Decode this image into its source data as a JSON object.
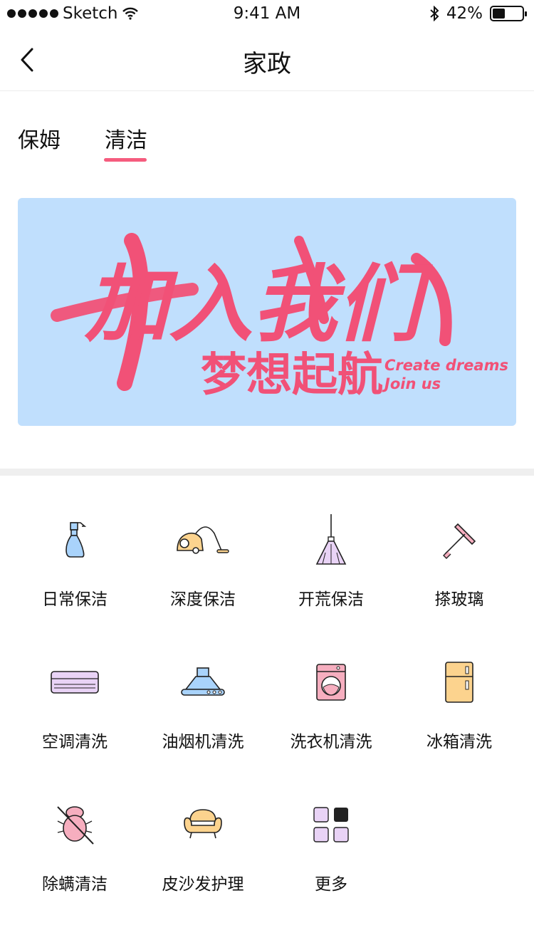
{
  "status": {
    "carrier": "Sketch",
    "time": "9:41 AM",
    "battery": "42%",
    "battery_level": 0.42
  },
  "nav": {
    "title": "家政"
  },
  "tabs": [
    {
      "label": "保姆",
      "active": false
    },
    {
      "label": "清洁",
      "active": true
    }
  ],
  "banner": {
    "headline": "加入我们",
    "subline": "梦想起航",
    "en_line1": "Create dreams",
    "en_line2": "Join us"
  },
  "services": [
    {
      "label": "日常保洁",
      "icon": "spray-bottle-icon"
    },
    {
      "label": "深度保洁",
      "icon": "vacuum-cleaner-icon"
    },
    {
      "label": "开荒保洁",
      "icon": "broom-icon"
    },
    {
      "label": "搽玻璃",
      "icon": "window-squeegee-icon"
    },
    {
      "label": "空调清洗",
      "icon": "air-conditioner-icon"
    },
    {
      "label": "油烟机清洗",
      "icon": "range-hood-icon"
    },
    {
      "label": "洗衣机清洗",
      "icon": "washing-machine-icon"
    },
    {
      "label": "冰箱清洗",
      "icon": "refrigerator-icon"
    },
    {
      "label": "除螨清洁",
      "icon": "mite-removal-icon"
    },
    {
      "label": "皮沙发护理",
      "icon": "sofa-icon"
    },
    {
      "label": "更多",
      "icon": "more-grid-icon"
    }
  ],
  "colors": {
    "accent": "#F55C7E",
    "banner_bg": "#C0DFFD",
    "banner_text": "#F15177",
    "light_blue": "#A9D3FB",
    "light_purple": "#E9D3F6",
    "light_pink": "#F6AEBF",
    "light_orange": "#FCD38E"
  }
}
